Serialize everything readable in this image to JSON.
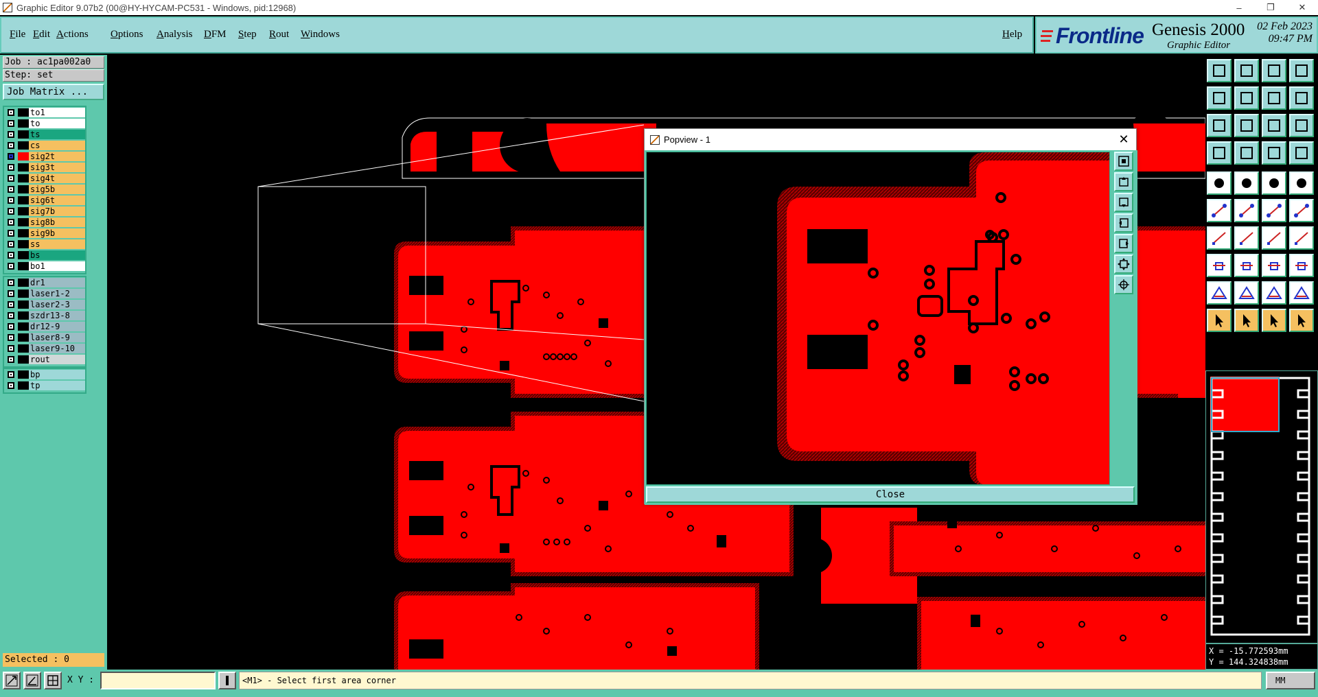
{
  "window": {
    "title": "Graphic Editor 9.07b2 (00@HY-HYCAM-PC531 - Windows, pid:12968)"
  },
  "menu": {
    "items": [
      "File",
      "Edit",
      "Actions",
      "Options",
      "Analysis",
      "DFM",
      "Step",
      "Rout",
      "Windows"
    ],
    "help": "Help"
  },
  "brand": {
    "logo": "Frontline",
    "product": "Genesis 2000",
    "subtitle": "Graphic Editor",
    "date": "02 Feb 2023",
    "time": "09:47 PM"
  },
  "left_panel": {
    "job": "Job : ac1pa002a0",
    "step": "Step: set",
    "job_matrix": "Job Matrix ...",
    "layer_groups": [
      [
        {
          "name": "to1",
          "color": "#ffffff"
        },
        {
          "name": "to",
          "color": "#ffffff"
        },
        {
          "name": "ts",
          "color": "#1aa680"
        },
        {
          "name": "cs",
          "color": "#f5c060"
        },
        {
          "name": "sig2t",
          "color": "#f5c060",
          "active": true
        },
        {
          "name": "sig3t",
          "color": "#f5c060"
        },
        {
          "name": "sig4t",
          "color": "#f5c060"
        },
        {
          "name": "sig5b",
          "color": "#f5c060"
        },
        {
          "name": "sig6t",
          "color": "#f5c060"
        },
        {
          "name": "sig7b",
          "color": "#f5c060"
        },
        {
          "name": "sig8b",
          "color": "#f5c060"
        },
        {
          "name": "sig9b",
          "color": "#f5c060"
        },
        {
          "name": "ss",
          "color": "#f5c060"
        },
        {
          "name": "bs",
          "color": "#1aa680"
        },
        {
          "name": "bo1",
          "color": "#ffffff"
        }
      ],
      [
        {
          "name": "dr1",
          "color": "#9bbcc4"
        },
        {
          "name": "laser1-2",
          "color": "#9bbcc4"
        },
        {
          "name": "laser2-3",
          "color": "#9bbcc4"
        },
        {
          "name": "szdr13-8",
          "color": "#9bbcc4"
        },
        {
          "name": "dr12-9",
          "color": "#9bbcc4"
        },
        {
          "name": "laser8-9",
          "color": "#9bbcc4"
        },
        {
          "name": "laser9-10",
          "color": "#9bbcc4"
        },
        {
          "name": "rout",
          "color": "#cfd8d8"
        }
      ],
      [
        {
          "name": "bp",
          "color": "#9ed8d8"
        },
        {
          "name": "tp",
          "color": "#9ed8d8"
        }
      ]
    ],
    "selected": "Selected : 0"
  },
  "popview": {
    "title": "Popview - 1",
    "close_label": "Close"
  },
  "toolbox": {
    "button_icons": [
      "zoom-up-icon",
      "zoom-down-icon",
      "home-icon",
      "split-view-icon",
      "pan-left-icon",
      "pan-right-icon",
      "rotate-icon",
      "mirror-icon",
      "fit-icon",
      "center-icon",
      "scale-1-2-icon",
      "help-icon",
      "snap-icon",
      "grid-icon",
      "layer-a-icon",
      "layer-b-icon",
      "pad-icon",
      "polygon-icon",
      "measure-icon",
      "filled-circle-icon",
      "node-icon",
      "cross-icon",
      "line-node-icon",
      "line-arrow-icon",
      "arc-icon",
      "slash-icon",
      "curve-icon",
      "align-icon",
      "pad-add-icon",
      "minus-icon",
      "frame-icon",
      "cluster-icon",
      "triangle-icon",
      "triangle-outline-icon",
      "bridge-icon",
      "bridge-flat-icon",
      "pointer-icon",
      "pointer-select-icon",
      "pointer-edit-icon",
      "pointer-multi-icon"
    ],
    "coords": {
      "x": "X = -15.772593mm",
      "y": "Y = 144.324838mm"
    }
  },
  "statusbar": {
    "xy_label": "X Y :",
    "xy_value": "",
    "message": "<M1> - Select first area corner",
    "units": "MM"
  },
  "colors": {
    "copper": "#ff0000",
    "panel": "#5ec8ac",
    "menu": "#9ed8d8",
    "highlight": "#f5c060"
  }
}
